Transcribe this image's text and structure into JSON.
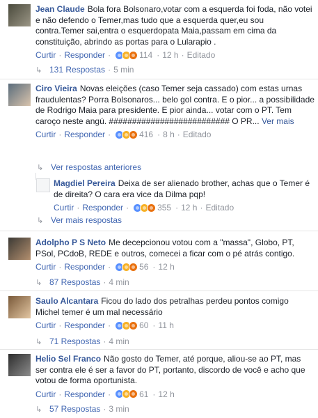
{
  "actions": {
    "like": "Curtir",
    "reply": "Responder",
    "edited": "Editado"
  },
  "comments": [
    {
      "author": "Jean Claude",
      "text": "Bola fora Bolsonaro,votar com a esquerda foi foda, não votei e não defendo o Temer,mas tudo que a esquerda quer,eu sou contra.Temer sai,entra o esquerdopata Maia,passam em cima da constituição, abrindo as portas para o Lularapio .",
      "reaction_count": "114",
      "time": "12 h",
      "edited": true,
      "replies_label": "131 Respostas",
      "replies_time": "5 min",
      "avatar_colors": [
        "#4a4a3c",
        "#9b9686"
      ]
    },
    {
      "author": "Ciro Vieira",
      "text": "Novas eleições (caso Temer seja cassado) com estas urnas fraudulentas? Porra Bolsonaros... belo gol contra. E o pior... a possibilidade de Rodrigo Maia para presidente. E pior ainda... votar com o PT. Tem caroço neste angú. ########################## O PR...",
      "more": "Ver mais",
      "reaction_count": "416",
      "time": "8 h",
      "edited": true,
      "prev_replies": "Ver respostas anteriores",
      "reply": {
        "author": "Magdiel Pereira",
        "text": "Deixa de ser alienado brother, achas que o Temer é de direita? O cara era vice da Dilma pqp!",
        "reaction_count": "355",
        "time": "12 h",
        "edited": true
      },
      "more_replies": "Ver mais respostas",
      "avatar_colors": [
        "#5b6d7c",
        "#d9c4ad"
      ]
    },
    {
      "author": "Adolpho P S Neto",
      "text": "Me decepcionou votou com a \"massa\", Globo, PT, PSol, PCdoB, REDE e outros, comecei a ficar com o pé atrás contigo.",
      "reaction_count": "56",
      "time": "12 h",
      "replies_label": "87 Respostas",
      "replies_time": "4 min",
      "avatar_colors": [
        "#3c3a35",
        "#b38f6e"
      ]
    },
    {
      "author": "Saulo Alcantara",
      "text": "Ficou do lado dos petralhas perdeu pontos comigo Michel temer é um mal necessário",
      "reaction_count": "60",
      "time": "11 h",
      "replies_label": "71 Respostas",
      "replies_time": "4 min",
      "avatar_colors": [
        "#7a5a3a",
        "#e3c6a2"
      ]
    },
    {
      "author": "Helio Sel Franco",
      "text": "Não gosto do Temer, até porque, aliou-se ao PT, mas ser contra ele é ser a favor do PT, portanto, discordo de você e acho que votou de forma oportunista.",
      "reaction_count": "61",
      "time": "12 h",
      "replies_label": "57 Respostas",
      "replies_time": "3 min",
      "avatar_colors": [
        "#2d2d2d",
        "#8c8c8c"
      ]
    }
  ]
}
